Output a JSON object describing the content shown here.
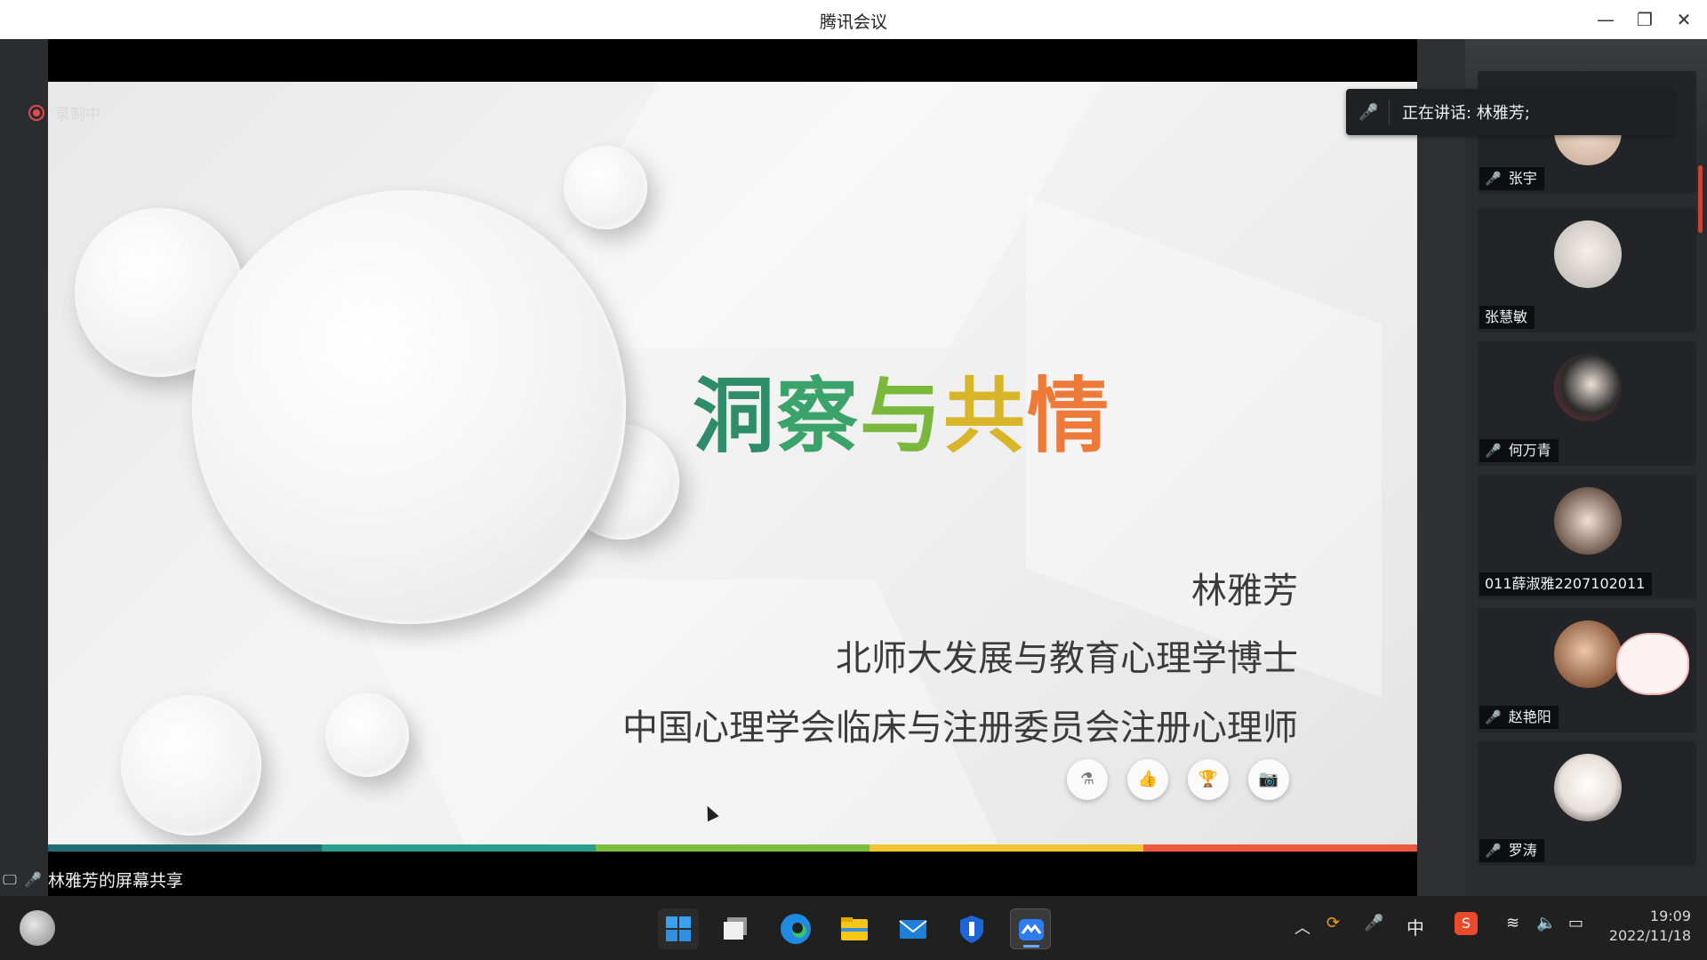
{
  "window": {
    "title": "腾讯会议",
    "minimize_glyph": "—",
    "restore_glyph": "❐",
    "close_glyph": "✕"
  },
  "recording": {
    "label": "录制中",
    "color": "#e24a4a"
  },
  "speaking": {
    "text": "正在讲话: 林雅芳;",
    "icon": "mic-muted-icon"
  },
  "slide": {
    "title_chars": [
      {
        "char": "洞",
        "color": "#2e8c6a"
      },
      {
        "char": "察",
        "color": "#3aa36a"
      },
      {
        "char": "与",
        "color": "#79b83a"
      },
      {
        "char": "共",
        "color": "#d9b52a"
      },
      {
        "char": "情",
        "color": "#ee7a3a"
      }
    ],
    "name": "林雅芳",
    "line2": "北师大发展与教育心理学博士",
    "line3": "中国心理学会临床与注册委员会注册心理师",
    "tools": [
      {
        "icon": "flask-icon",
        "glyph": "⚗"
      },
      {
        "icon": "thumbs-up-icon",
        "glyph": "👍"
      },
      {
        "icon": "trophy-icon",
        "glyph": "🏆"
      },
      {
        "icon": "camera-icon",
        "glyph": "📷"
      }
    ],
    "color_bar": [
      "#1f6e78",
      "#2aa08a",
      "#7cbf3e",
      "#efc534",
      "#ee5a3e"
    ]
  },
  "participants": [
    {
      "name": "张宇",
      "muted": true
    },
    {
      "name": "张慧敏",
      "muted": false
    },
    {
      "name": "何万青",
      "muted": true
    },
    {
      "name": "011薛淑雅2207102011",
      "muted": false
    },
    {
      "name": "赵艳阳",
      "muted": true
    },
    {
      "name": "罗涛",
      "muted": true
    }
  ],
  "share_footer": {
    "text": "林雅芳的屏幕共享"
  },
  "taskbar": {
    "ime": "中",
    "time": "19:09",
    "date": "2022/11/18"
  }
}
